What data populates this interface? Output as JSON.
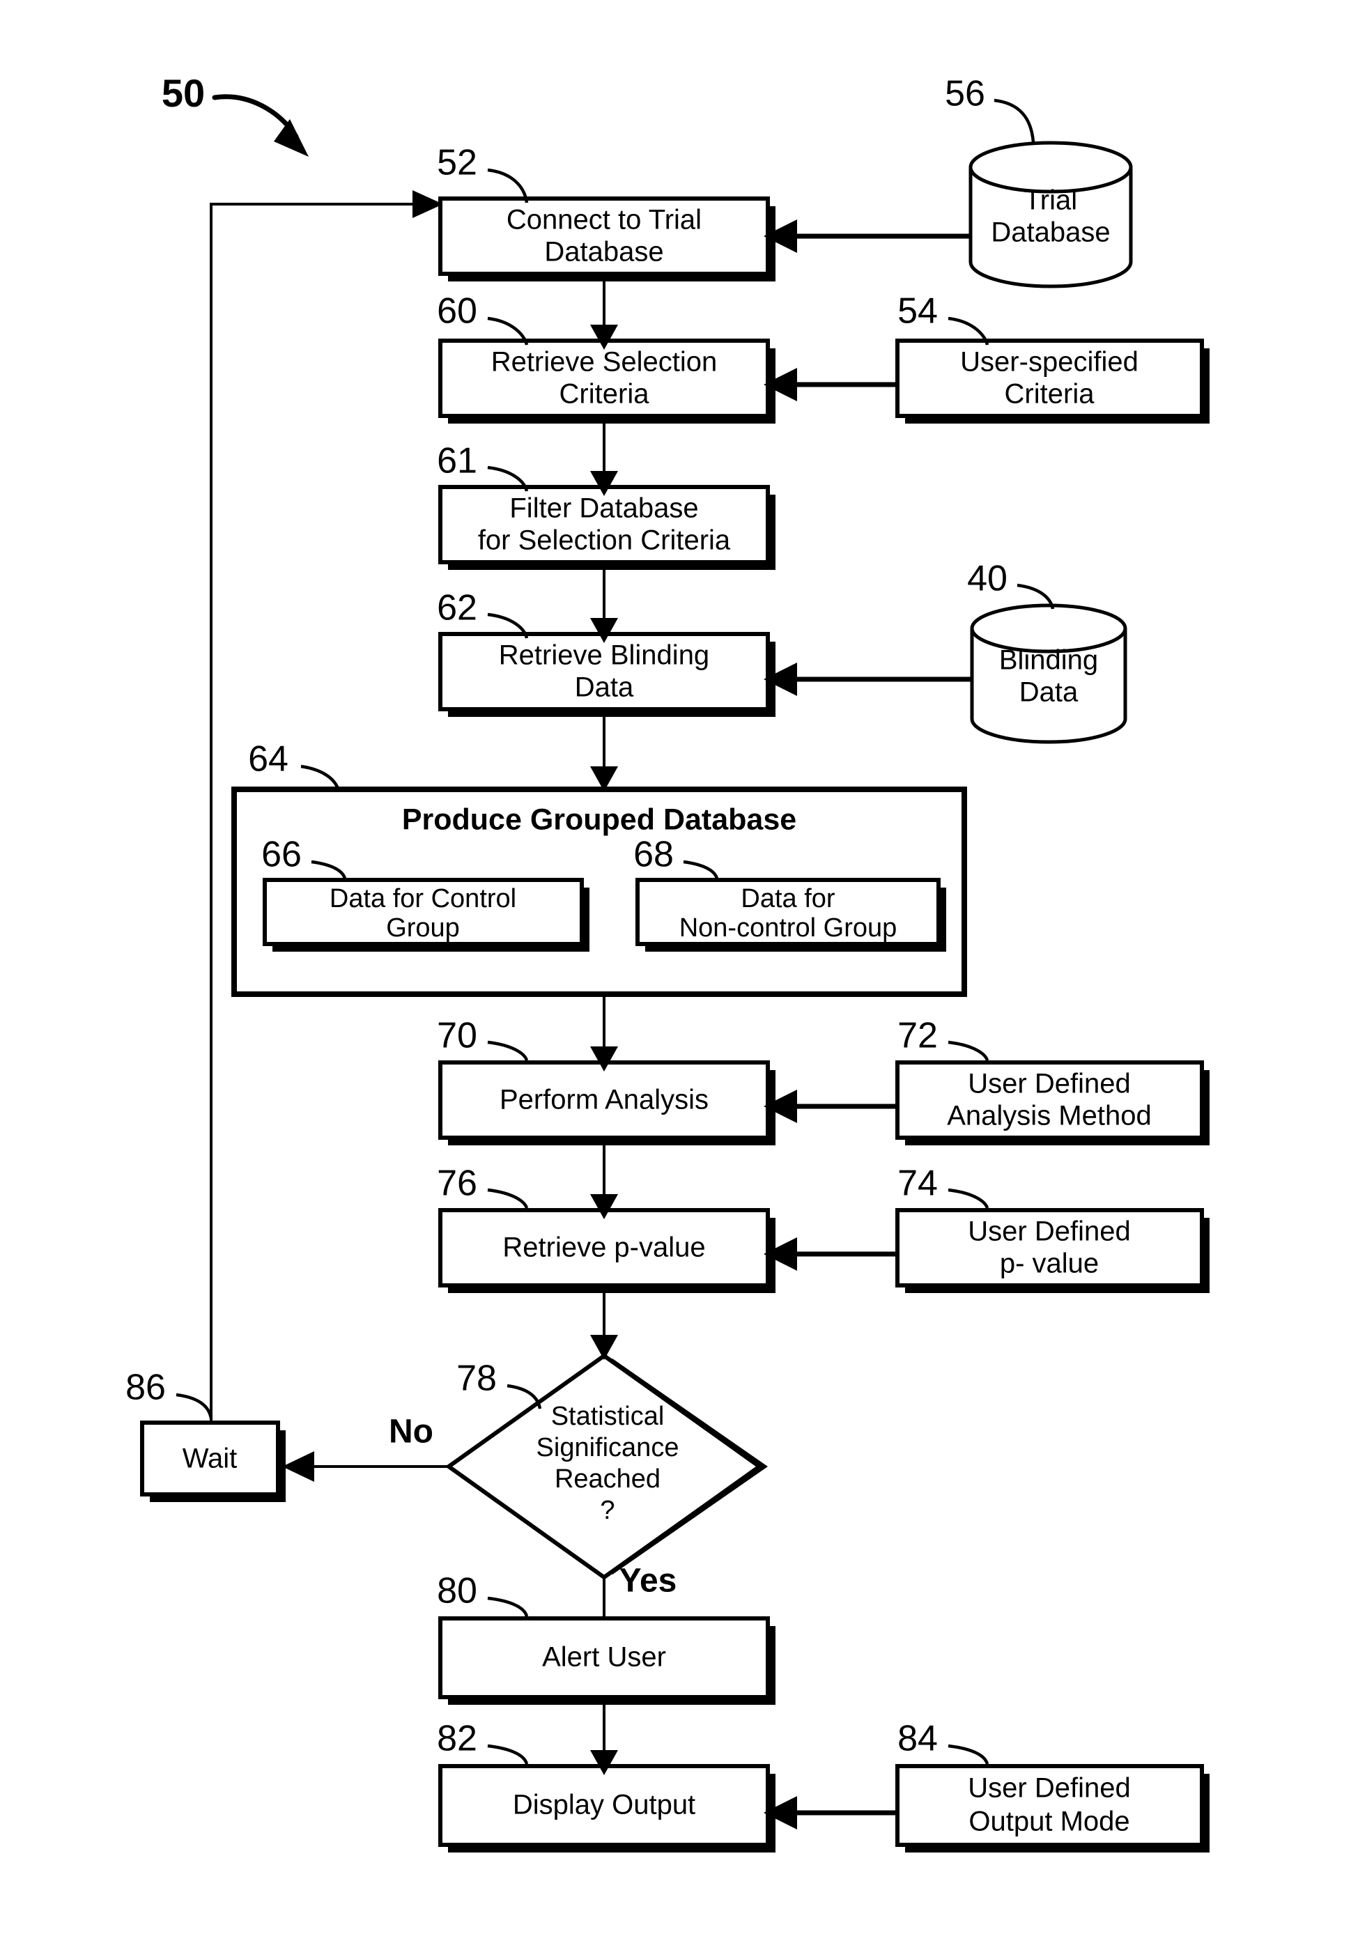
{
  "figure": {
    "figure_ref": "50",
    "nodes": [
      {
        "ref": "52",
        "label_lines": [
          "Connect to Trial",
          "Database"
        ],
        "shape": "process"
      },
      {
        "ref": "56",
        "label_lines": [
          "Trial",
          "Database"
        ],
        "shape": "cylinder"
      },
      {
        "ref": "60",
        "label_lines": [
          "Retrieve Selection",
          "Criteria"
        ],
        "shape": "process"
      },
      {
        "ref": "54",
        "label_lines": [
          "User-specified",
          "Criteria"
        ],
        "shape": "process"
      },
      {
        "ref": "61",
        "label_lines": [
          "Filter Database",
          "for Selection Criteria"
        ],
        "shape": "process"
      },
      {
        "ref": "62",
        "label_lines": [
          "Retrieve Blinding",
          "Data"
        ],
        "shape": "process"
      },
      {
        "ref": "40",
        "label_lines": [
          "Blinding",
          "Data"
        ],
        "shape": "cylinder"
      },
      {
        "ref": "64",
        "label_lines": [
          "Produce Grouped Database"
        ],
        "shape": "group"
      },
      {
        "ref": "66",
        "label_lines": [
          "Data for Control",
          "Group"
        ],
        "shape": "process"
      },
      {
        "ref": "68",
        "label_lines": [
          "Data for",
          "Non-control Group"
        ],
        "shape": "process"
      },
      {
        "ref": "70",
        "label_lines": [
          "Perform Analysis"
        ],
        "shape": "process"
      },
      {
        "ref": "72",
        "label_lines": [
          "User Defined",
          "Analysis Method"
        ],
        "shape": "process"
      },
      {
        "ref": "76",
        "label_lines": [
          "Retrieve p-value"
        ],
        "shape": "process"
      },
      {
        "ref": "74",
        "label_lines": [
          "User Defined",
          "p- value"
        ],
        "shape": "process"
      },
      {
        "ref": "78",
        "label_lines": [
          "Statistical",
          "Significance",
          "Reached",
          "?"
        ],
        "shape": "decision"
      },
      {
        "ref": "86",
        "label_lines": [
          "Wait"
        ],
        "shape": "process"
      },
      {
        "ref": "80",
        "label_lines": [
          "Alert User"
        ],
        "shape": "process"
      },
      {
        "ref": "82",
        "label_lines": [
          "Display Output"
        ],
        "shape": "process"
      },
      {
        "ref": "84",
        "label_lines": [
          "User Defined",
          "Output Mode"
        ],
        "shape": "process"
      }
    ],
    "branch_labels": {
      "no": "No",
      "yes": "Yes"
    },
    "colors": {
      "ink": "#000000",
      "paper": "#ffffff"
    }
  }
}
